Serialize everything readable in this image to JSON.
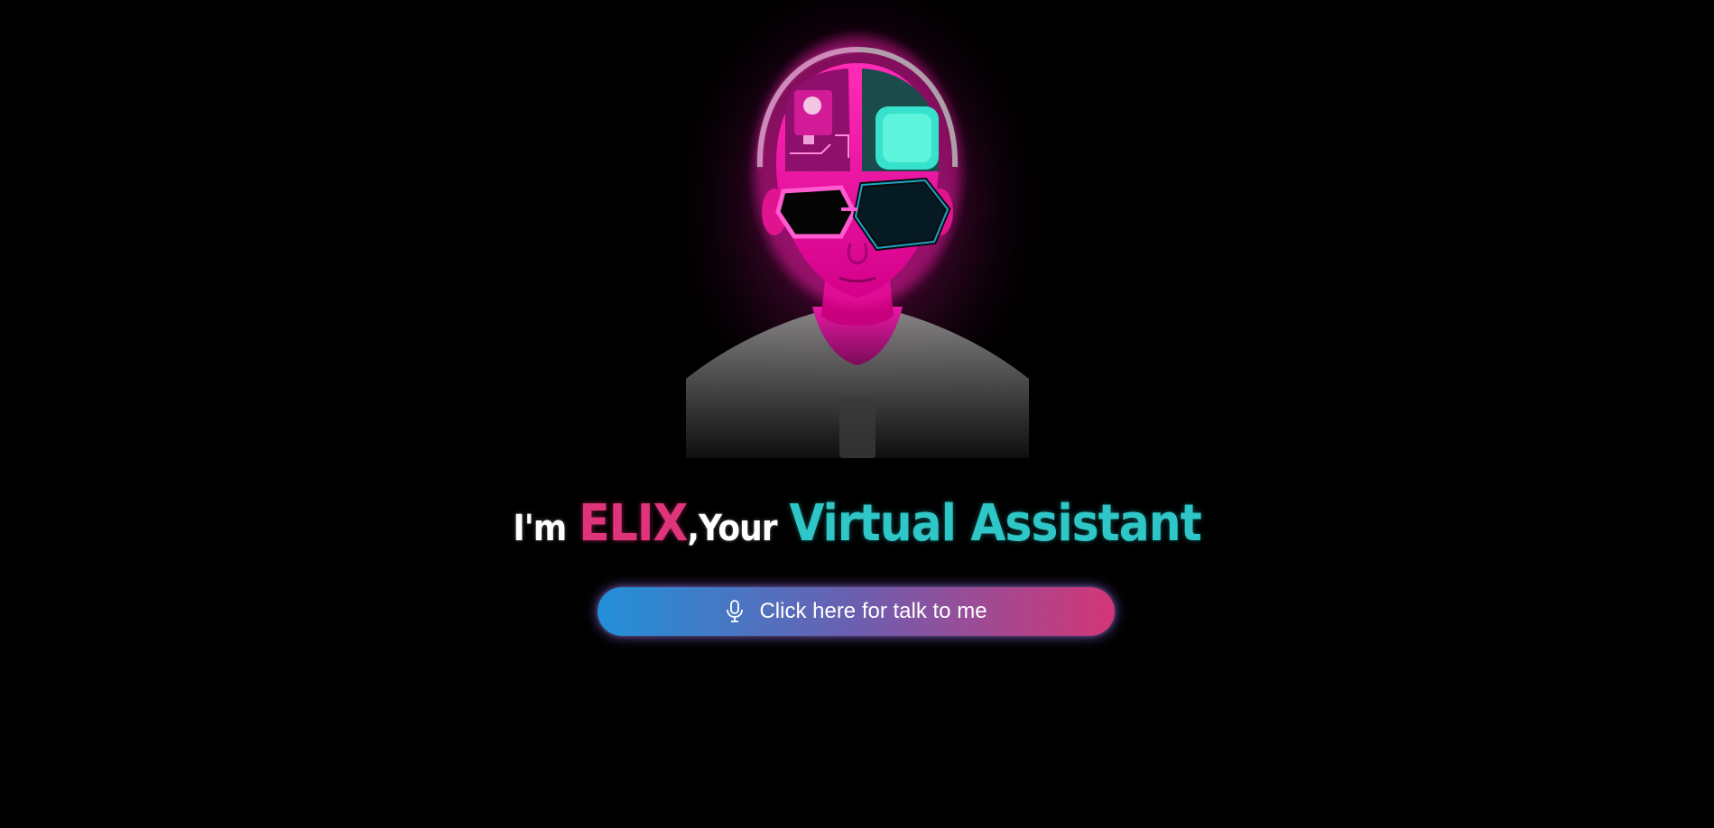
{
  "hero": {
    "avatar_icon": "cyberpunk-avatar-illustration",
    "headline": {
      "part_1": "I'm",
      "name": "ELIX",
      "part_2": ",Your",
      "accent": "Virtual Assistant"
    }
  },
  "talk_button": {
    "label": "Click here for talk to me",
    "icon": "microphone-icon"
  },
  "colors": {
    "background": "#000000",
    "name": "#e0347a",
    "accent": "#2ec6c6",
    "button_start": "#2190d8",
    "button_end": "#d33678"
  }
}
